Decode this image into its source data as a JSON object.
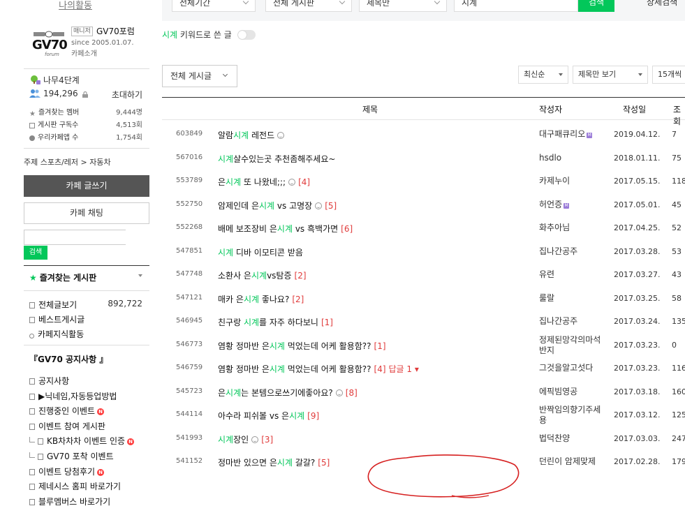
{
  "sidebar": {
    "section_title": "나의활동",
    "cafe": {
      "logo_text": "GV70",
      "logo_sub": "forum",
      "manager_badge": "매니저",
      "name": "GV70포럼",
      "since": "since 2005.01.07.",
      "intro": "카페소개"
    },
    "level": "나무4단계",
    "member_count": "194,296",
    "invite": "초대하기",
    "stats": [
      {
        "label": "즐겨찾는 멤버",
        "value": "9,444명"
      },
      {
        "label": "게시판 구독수",
        "value": "4,513회"
      },
      {
        "label": "우리카페앱 수",
        "value": "1,754회"
      }
    ],
    "category": "주제  스포츠/레저 > 자동차",
    "write_button": "카페 글쓰기",
    "chat_button": "카페 채팅",
    "search_button": "검색",
    "fav_title": "즐겨찾는 게시판",
    "fav_items": [
      {
        "label": "전체글보기",
        "count": "892,722"
      },
      {
        "label": "베스트게시글",
        "count": ""
      },
      {
        "label": "카페지식활동",
        "count": ""
      }
    ],
    "notice_title": "『GV70 공지사항 』",
    "notice_items": [
      {
        "label": "공지사항",
        "new": false,
        "sub": false
      },
      {
        "label": "▶닉네임,자동등업방법",
        "new": false,
        "sub": false
      },
      {
        "label": "진행중인 이벤트",
        "new": true,
        "sub": false
      },
      {
        "label": "이벤트 참여 게시판",
        "new": false,
        "sub": false
      },
      {
        "label": "KB차차차 이벤트 인증",
        "new": true,
        "sub": true
      },
      {
        "label": "GV70 포착 이벤트",
        "new": false,
        "sub": true
      },
      {
        "label": "이벤트 당첨후기",
        "new": true,
        "sub": false
      },
      {
        "label": "제네시스 홈피 바로가기",
        "new": false,
        "sub": false
      },
      {
        "label": "블루멤버스 바로가기",
        "new": false,
        "sub": false
      }
    ],
    "new_badge_text": "N"
  },
  "main": {
    "search": {
      "period": "전체기간",
      "board": "전체 게시판",
      "field": "제목만",
      "query": "시계",
      "button": "검색",
      "detail": "상세검색"
    },
    "keyword_row": {
      "keyword": "시계",
      "text": "키워드로 쓴 글"
    },
    "board_select": "전체 게시글",
    "sort": "최신순",
    "view": "제목만 보기",
    "per_page": "15개씩",
    "headers": {
      "title": "제목",
      "author": "작성자",
      "date": "작성일",
      "views": "조회"
    },
    "rows": [
      {
        "num": "603849",
        "pre": "알람",
        "hl": "시계",
        "post": " 레전드",
        "emo": true,
        "cmt": "",
        "reply": "",
        "author": "대구패큐리오",
        "author2": "",
        "badge": true,
        "date": "2019.04.12.",
        "views": "7"
      },
      {
        "num": "567016",
        "pre": "",
        "hl": "시계",
        "post": "살수있는곳 추천좀해주세요~",
        "emo": false,
        "cmt": "",
        "reply": "",
        "author": "hsdlo",
        "author2": "",
        "badge": false,
        "date": "2018.01.11.",
        "views": "75"
      },
      {
        "num": "553789",
        "pre": "은",
        "hl": "시계",
        "post": " 또 나왔네;;;",
        "emo": true,
        "cmt": "[4]",
        "reply": "",
        "author": "카제누이",
        "author2": "",
        "badge": false,
        "date": "2017.05.15.",
        "views": "118"
      },
      {
        "num": "552750",
        "pre": "암제인데 은",
        "hl": "시계",
        "post": " vs 고명장",
        "emo": true,
        "cmt": "[5]",
        "reply": "",
        "author": "허언증",
        "author2": "",
        "badge": true,
        "date": "2017.05.01.",
        "views": "45"
      },
      {
        "num": "552268",
        "pre": "배메 보조장비 은",
        "hl": "시계",
        "post": " vs 흑백가면",
        "emo": false,
        "cmt": "[6]",
        "reply": "",
        "author": "화추아님",
        "author2": "",
        "badge": false,
        "date": "2017.04.25.",
        "views": "52"
      },
      {
        "num": "547851",
        "pre": "",
        "hl": "시계",
        "post": " 디바 이모티콘 받음",
        "emo": false,
        "cmt": "",
        "reply": "",
        "author": "집나간공주",
        "author2": "",
        "badge": false,
        "date": "2017.03.28.",
        "views": "53"
      },
      {
        "num": "547748",
        "pre": "소환사 은",
        "hl": "시계",
        "post": "vs탐증",
        "emo": false,
        "cmt": "[2]",
        "reply": "",
        "author": "유련",
        "author2": "",
        "badge": false,
        "date": "2017.03.27.",
        "views": "43"
      },
      {
        "num": "547121",
        "pre": "매카 은",
        "hl": "시계",
        "post": " 좋나요?",
        "emo": false,
        "cmt": "[2]",
        "reply": "",
        "author": "룰랄",
        "author2": "",
        "badge": false,
        "date": "2017.03.25.",
        "views": "58"
      },
      {
        "num": "546945",
        "pre": "친구랑 ",
        "hl": "시계",
        "post": "를 자주 하다보니",
        "emo": false,
        "cmt": "[1]",
        "reply": "",
        "author": "집나간공주",
        "author2": "",
        "badge": false,
        "date": "2017.03.24.",
        "views": "135"
      },
      {
        "num": "546773",
        "pre": "염황 정마반 은",
        "hl": "시계",
        "post": " 먹었는데 어케 활용함??",
        "emo": false,
        "cmt": "[1]",
        "reply": "",
        "author": "정제된망각의마석",
        "author2": "반지",
        "badge": false,
        "date": "2017.03.23.",
        "views": "0"
      },
      {
        "num": "546759",
        "pre": "염황 정마반 은",
        "hl": "시계",
        "post": " 먹었는데 어케 활용함??",
        "emo": false,
        "cmt": "[4]",
        "reply": "답글 1 ▾",
        "author": "그것을알고섯다",
        "author2": "",
        "badge": false,
        "date": "2017.03.23.",
        "views": "116"
      },
      {
        "num": "545723",
        "pre": "은",
        "hl": "시계",
        "post": "는 본템으로쓰기에좋아요?",
        "emo": true,
        "cmt": "[8]",
        "reply": "",
        "author": "에픽빔영공",
        "author2": "",
        "badge": false,
        "date": "2017.03.18.",
        "views": "160"
      },
      {
        "num": "544114",
        "pre": "아수라 피쉬볼 vs 은",
        "hl": "시계",
        "post": "",
        "emo": false,
        "cmt": "[9]",
        "reply": "",
        "author": "반짝임의향기주세",
        "author2": "용",
        "badge": false,
        "date": "2017.03.12.",
        "views": "125"
      },
      {
        "num": "541993",
        "pre": "",
        "hl": "시계",
        "post": "장인",
        "emo": true,
        "cmt": "[3]",
        "reply": "",
        "author": "법덕찬양",
        "author2": "",
        "badge": false,
        "date": "2017.03.03.",
        "views": "247"
      },
      {
        "num": "541152",
        "pre": "정마반 있으면 은",
        "hl": "시계",
        "post": " 갈갈?",
        "emo": false,
        "cmt": "[5]",
        "reply": "",
        "author": "던린이 암제맞제",
        "author2": "",
        "badge": false,
        "date": "2017.02.28.",
        "views": "179"
      }
    ],
    "member_badge_text": "M"
  },
  "colors": {
    "accent": "#03c75a",
    "comment": "#e03b3b",
    "annotation": "#d62020"
  }
}
